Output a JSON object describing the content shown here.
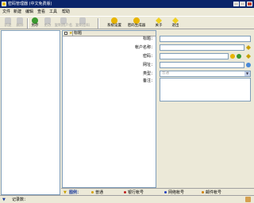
{
  "window": {
    "title": "密码管理器 (中文免费版)"
  },
  "menu": [
    "文件",
    "新建",
    "编辑",
    "查看",
    "工具",
    "帮助"
  ],
  "toolbar": {
    "items": [
      {
        "label": "新建",
        "icon": "new-icon",
        "enabled": false
      },
      {
        "label": "删除",
        "icon": "delete-icon",
        "enabled": false
      },
      {
        "label": "另存",
        "icon": "save-as-icon",
        "enabled": true
      },
      {
        "label": "更改",
        "icon": "edit-icon",
        "enabled": false
      },
      {
        "label": "复制用户名",
        "icon": "copy-user-icon",
        "enabled": false
      },
      {
        "label": "复制密码",
        "icon": "copy-password-icon",
        "enabled": false
      },
      {
        "label": "系统设置",
        "icon": "settings-icon",
        "enabled": true
      },
      {
        "label": "密码生成器",
        "icon": "key-generator-icon",
        "enabled": true
      },
      {
        "label": "关于",
        "icon": "about-icon",
        "enabled": true
      },
      {
        "label": "退出",
        "icon": "exit-icon",
        "enabled": true
      }
    ]
  },
  "list": {
    "header": "标题"
  },
  "form": {
    "title_label": "标题：",
    "account_label": "帐户名称：",
    "password_label": "密码：",
    "url_label": "网址：",
    "type_label": "类型：",
    "type_value": "普通",
    "notes_label": "备注："
  },
  "legend": {
    "title": "图例：",
    "items": [
      {
        "label": "普通",
        "color": "#d4a000"
      },
      {
        "label": "银行帐号",
        "color": "#c02020"
      },
      {
        "label": "网络帐号",
        "color": "#2040c0"
      },
      {
        "label": "邮件帐号",
        "color": "#d08000"
      }
    ]
  },
  "status": {
    "record_count_label": "记录数："
  },
  "colors": {
    "titlebar": "#0a246a",
    "panel_border": "#7f9db9"
  }
}
